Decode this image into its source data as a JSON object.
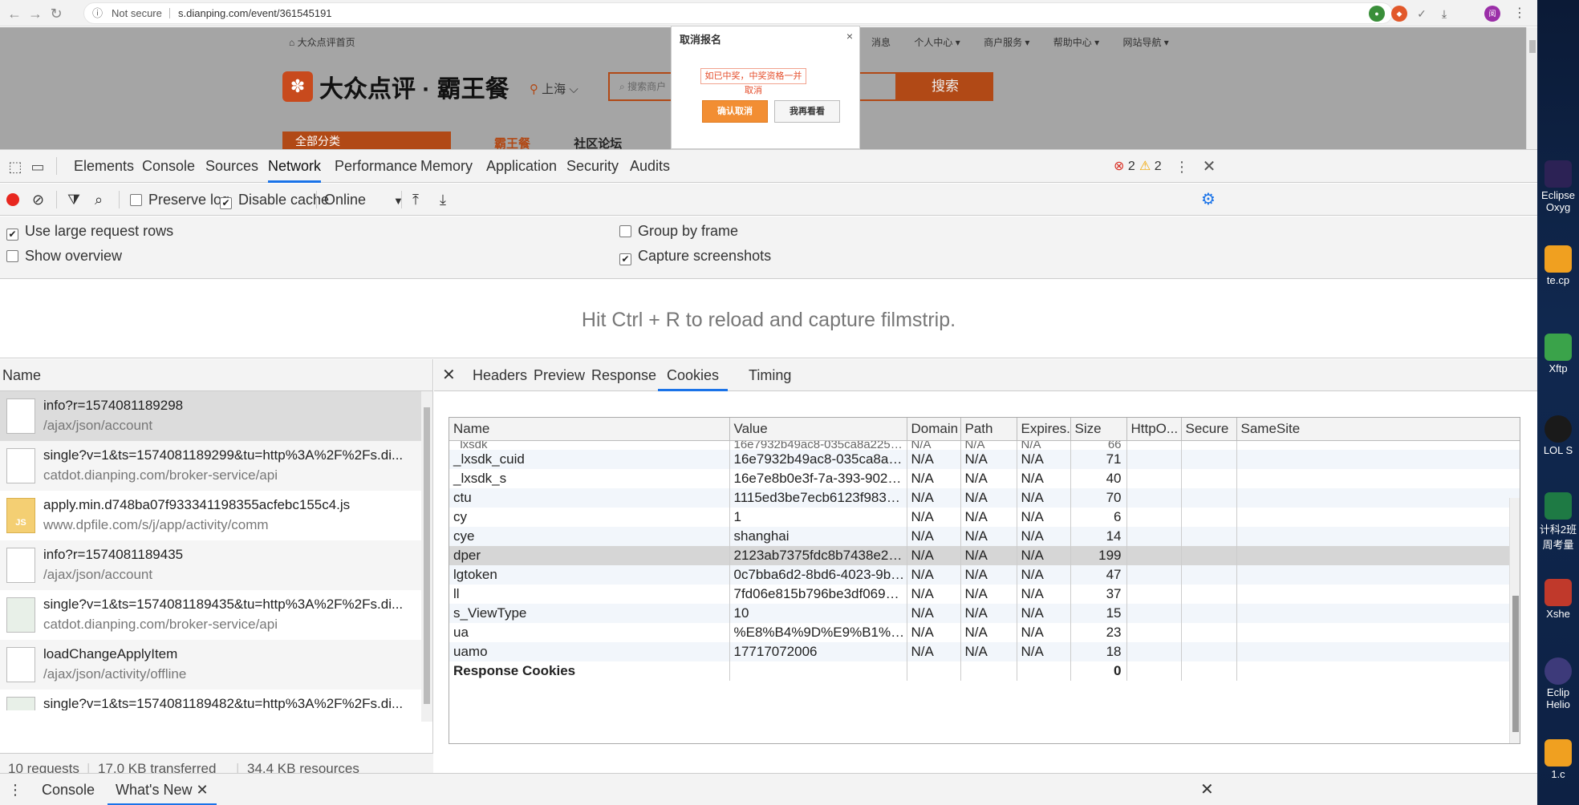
{
  "browser": {
    "back": "←",
    "forward": "→",
    "reload": "↻",
    "security_label": "Not secure",
    "url": "s.dianping.com/event/361545191"
  },
  "page": {
    "home_link": "大众点评首页",
    "top_links": [
      "消息",
      "个人中心 ▾",
      "商户服务 ▾",
      "帮助中心 ▾",
      "网站导航 ▾"
    ],
    "logo_text": "大众点评 · 霸王餐",
    "city": "上海 ⌵",
    "search_placeholder": "搜索商户",
    "search_button": "搜索",
    "category_label": "全部分类",
    "category_tabs": [
      "霸王餐",
      "社区论坛"
    ]
  },
  "modal": {
    "title": "取消报名",
    "close": "×",
    "warning": "如已中奖，中奖资格一并取消",
    "confirm": "确认取消",
    "reconsider": "我再看看"
  },
  "devtools": {
    "tabs": [
      "Elements",
      "Console",
      "Sources",
      "Network",
      "Performance",
      "Memory",
      "Application",
      "Security",
      "Audits"
    ],
    "active_tab": "Network",
    "errors": "2",
    "warnings": "2",
    "toolbar": {
      "preserve_log": "Preserve log",
      "disable_cache": "Disable cache",
      "throttle": "Online"
    },
    "settings": {
      "large_rows": "Use large request rows",
      "show_overview": "Show overview",
      "group_by_frame": "Group by frame",
      "capture_screenshots": "Capture screenshots"
    },
    "filmstrip_message": "Hit Ctrl + R to reload and capture filmstrip.",
    "request_list": {
      "header": "Name",
      "items": [
        {
          "name": "info?r=1574081189298",
          "path": "/ajax/json/account"
        },
        {
          "name": "single?v=1&ts=1574081189299&tu=http%3A%2F%2Fs.di...",
          "path": "catdot.dianping.com/broker-service/api"
        },
        {
          "name": "apply.min.d748ba07f933341198355acfebc155c4.js",
          "path": "www.dpfile.com/s/j/app/activity/comm"
        },
        {
          "name": "info?r=1574081189435",
          "path": "/ajax/json/account"
        },
        {
          "name": "single?v=1&ts=1574081189435&tu=http%3A%2F%2Fs.di...",
          "path": "catdot.dianping.com/broker-service/api"
        },
        {
          "name": "loadChangeApplyItem",
          "path": "/ajax/json/activity/offline"
        },
        {
          "name": "single?v=1&ts=1574081189482&tu=http%3A%2F%2Fs.di...",
          "path": ""
        }
      ]
    },
    "status": {
      "requests": "10 requests",
      "transferred": "17.0 KB transferred",
      "resources": "34.4 KB resources"
    },
    "detail_tabs": [
      "Headers",
      "Preview",
      "Response",
      "Cookies",
      "Timing"
    ],
    "active_detail_tab": "Cookies",
    "cookie_columns": [
      "Name",
      "Value",
      "Domain",
      "Path",
      "Expires...",
      "Size",
      "HttpO...",
      "Secure",
      "SameSite"
    ],
    "partial_row": {
      "name": "_lxsdk",
      "value": "16e7932b49ac8-035ca8a22574...",
      "domain": "N/A",
      "path": "N/A",
      "expires": "N/A",
      "size": "66"
    },
    "cookies": [
      {
        "name": "_lxsdk_cuid",
        "value": "16e7932b49ac8-035ca8a22574...",
        "domain": "N/A",
        "path": "N/A",
        "expires": "N/A",
        "size": "71"
      },
      {
        "name": "_lxsdk_s",
        "value": "16e7e8b0e3f-7a-393-902%7C...",
        "domain": "N/A",
        "path": "N/A",
        "expires": "N/A",
        "size": "40"
      },
      {
        "name": "ctu",
        "value": "1115ed3be7ecb6123f983e4487...",
        "domain": "N/A",
        "path": "N/A",
        "expires": "N/A",
        "size": "70"
      },
      {
        "name": "cy",
        "value": "1",
        "domain": "N/A",
        "path": "N/A",
        "expires": "N/A",
        "size": "6"
      },
      {
        "name": "cye",
        "value": "shanghai",
        "domain": "N/A",
        "path": "N/A",
        "expires": "N/A",
        "size": "14"
      },
      {
        "name": "dper",
        "value": "2123ab7375fdc8b7438e29eedd...",
        "domain": "N/A",
        "path": "N/A",
        "expires": "N/A",
        "size": "199"
      },
      {
        "name": "lgtoken",
        "value": "0c7bba6d2-8bd6-4023-9bc7-6...",
        "domain": "N/A",
        "path": "N/A",
        "expires": "N/A",
        "size": "47"
      },
      {
        "name": "ll",
        "value": "7fd06e815b796be3df069dec78...",
        "domain": "N/A",
        "path": "N/A",
        "expires": "N/A",
        "size": "37"
      },
      {
        "name": "s_ViewType",
        "value": "10",
        "domain": "N/A",
        "path": "N/A",
        "expires": "N/A",
        "size": "15"
      },
      {
        "name": "ua",
        "value": "%E8%B4%9D%E9%B1%BC",
        "domain": "N/A",
        "path": "N/A",
        "expires": "N/A",
        "size": "23"
      },
      {
        "name": "uamo",
        "value": "17717072006",
        "domain": "N/A",
        "path": "N/A",
        "expires": "N/A",
        "size": "18"
      }
    ],
    "response_cookies_label": "Response Cookies",
    "response_cookies_size": "0",
    "drawer_tabs": [
      "Console",
      "What's New"
    ]
  },
  "desktop": {
    "icons": [
      "Eclipse Oxyg",
      "te.cp",
      "Xftp",
      "LOL S",
      "计科2班 周考量",
      "Xshe",
      "Eclip Helio",
      "1.c"
    ]
  },
  "colors": {
    "accent_blue": "#1a73e8",
    "brand_orange": "#b14916",
    "record_red": "#e8271f",
    "modal_button": "#f28e33"
  }
}
